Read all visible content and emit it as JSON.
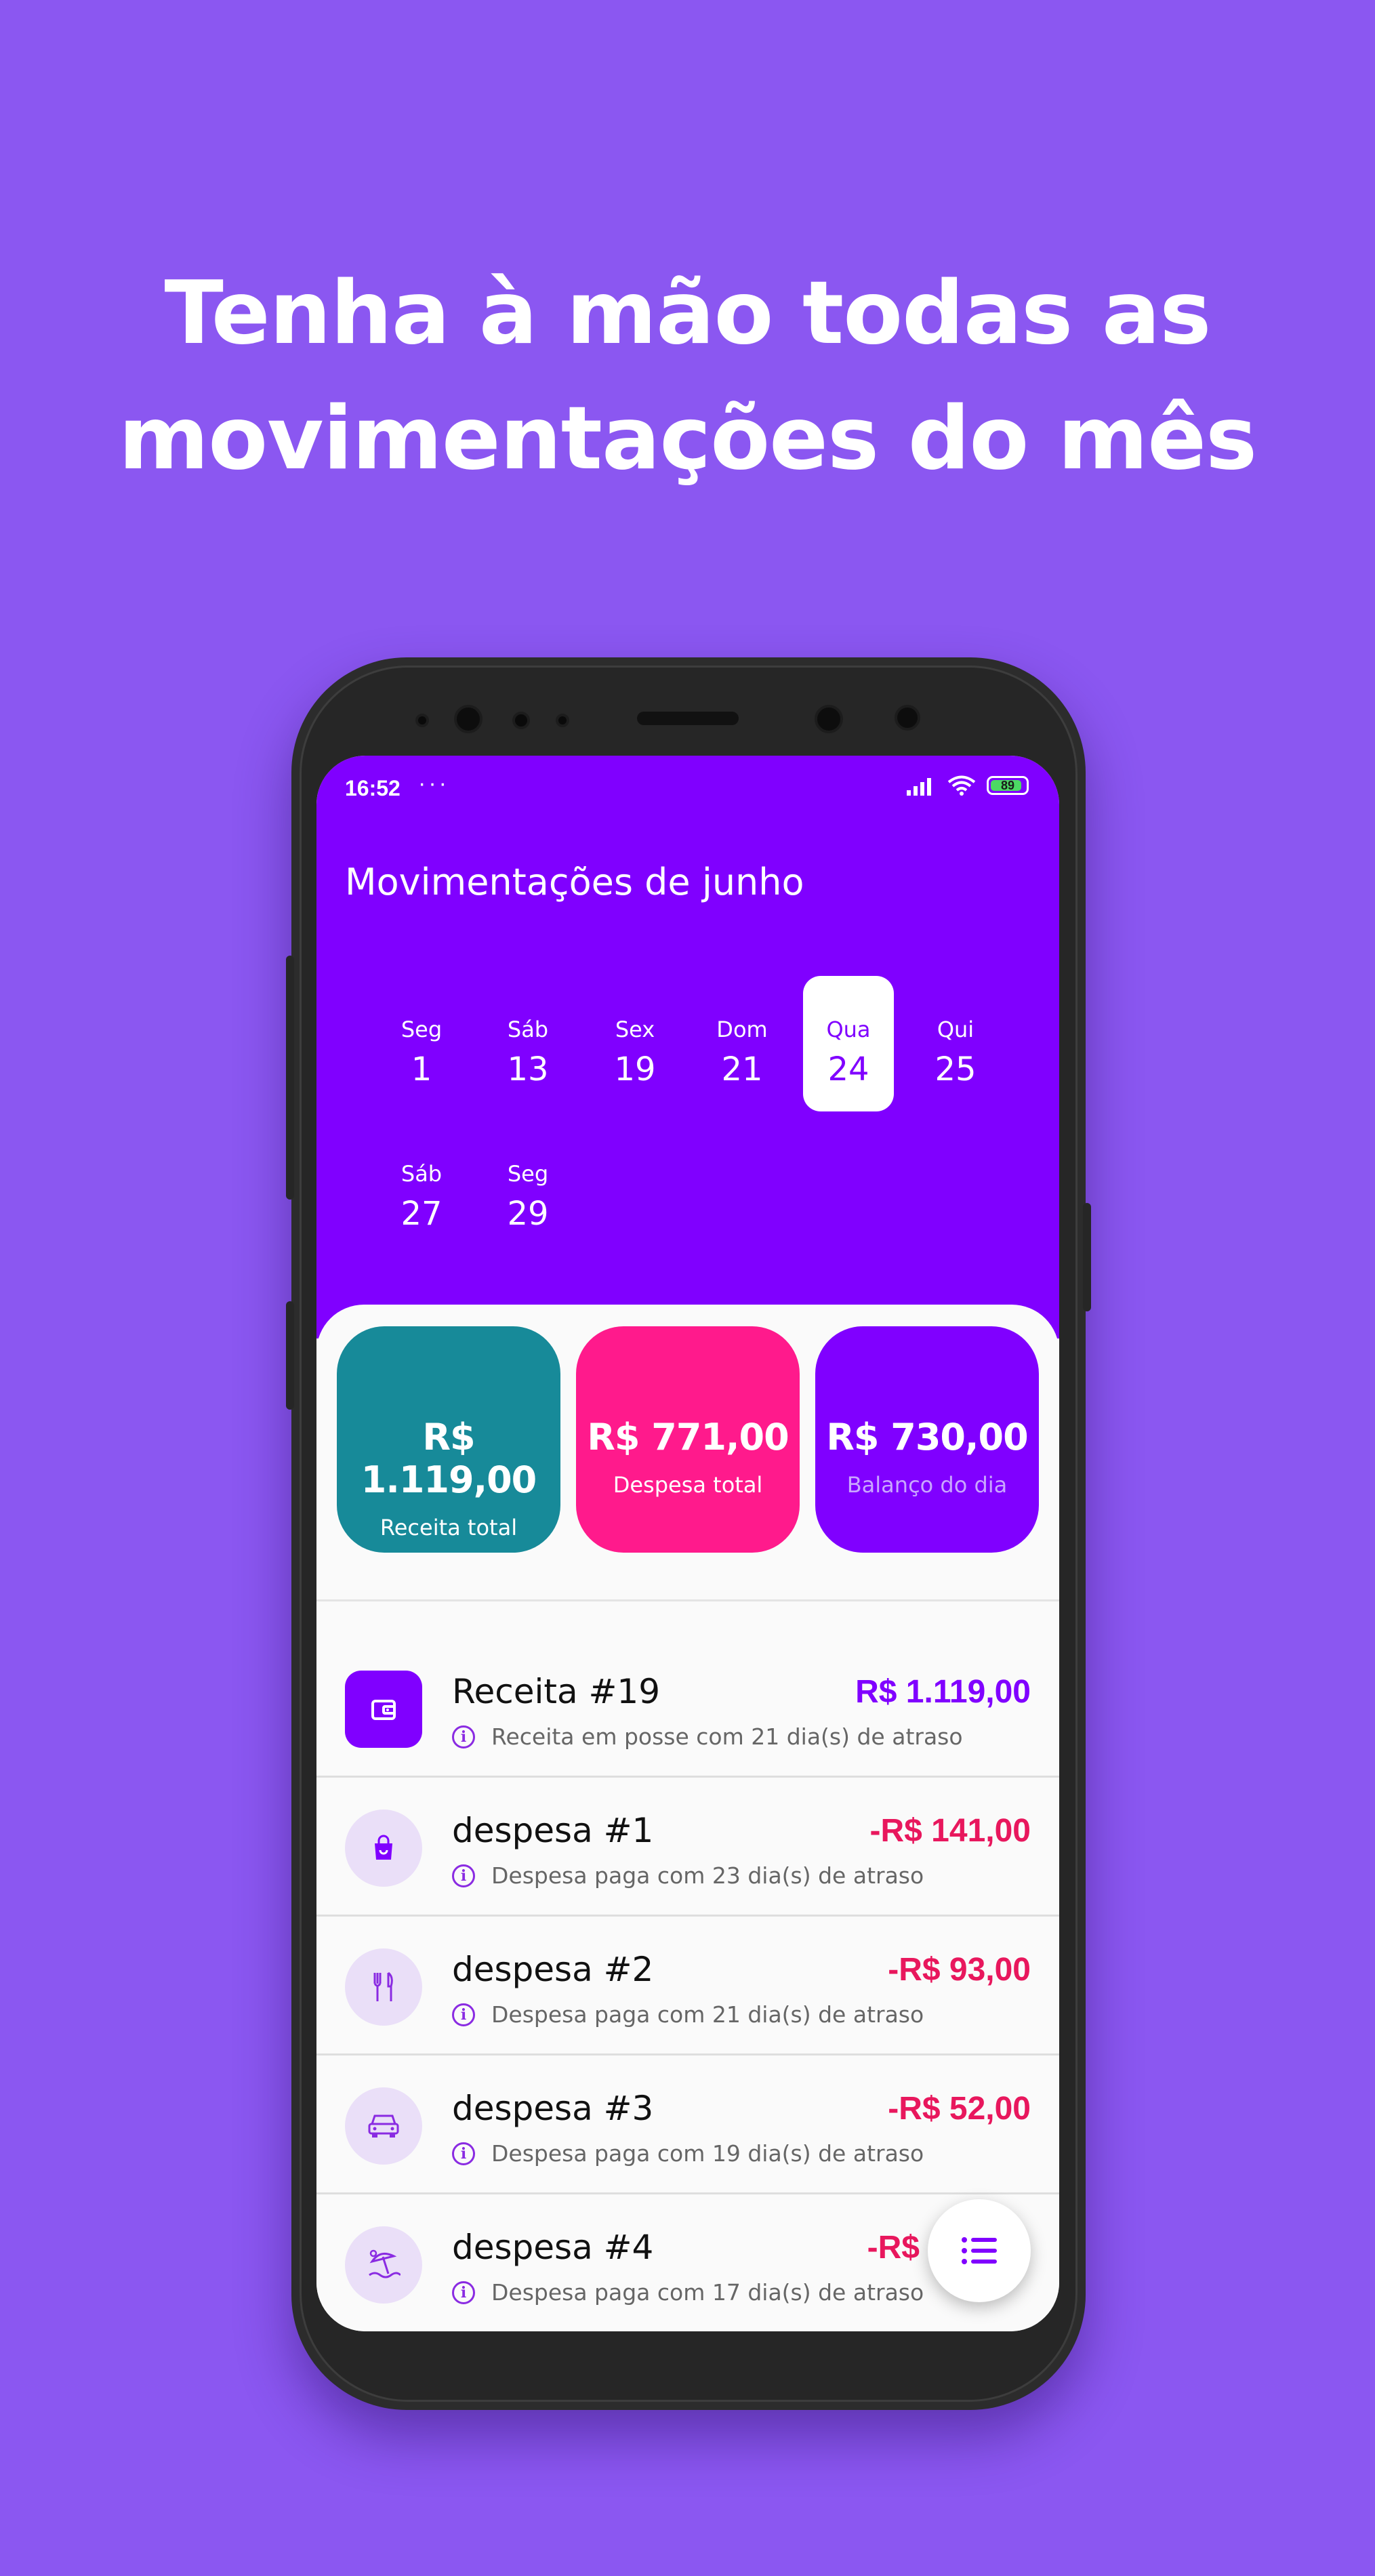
{
  "headline": {
    "line1": "Tenha à mão todas as",
    "line2": "movimentações do mês"
  },
  "status_bar": {
    "time": "16:52",
    "dots": "···",
    "battery": "89"
  },
  "screen_title": "Movimentações de junho",
  "days": [
    {
      "name": "Seg",
      "num": "1"
    },
    {
      "name": "Sáb",
      "num": "13"
    },
    {
      "name": "Sex",
      "num": "19"
    },
    {
      "name": "Dom",
      "num": "21"
    },
    {
      "name": "Qua",
      "num": "24",
      "selected": true
    },
    {
      "name": "Qui",
      "num": "25"
    },
    {
      "name": "Sáb",
      "num": "27"
    },
    {
      "name": "Seg",
      "num": "29"
    }
  ],
  "summary": {
    "income": {
      "amount": "R$ 1.119,00",
      "label": "Receita total",
      "color": "#178a99"
    },
    "expense": {
      "amount": "R$ 771,00",
      "label": "Despesa total",
      "color": "#ff1a8c"
    },
    "balance": {
      "amount": "R$ 730,00",
      "label": "Balanço do dia",
      "color": "#8000ff"
    }
  },
  "transactions": [
    {
      "title": "Receita #19",
      "amount": "R$ 1.119,00",
      "sub": "Receita em posse com 21 dia(s) de atraso",
      "icon": "wallet-icon",
      "type": "income"
    },
    {
      "title": "despesa #1",
      "amount": "-R$ 141,00",
      "sub": "Despesa paga com 23 dia(s) de atraso",
      "icon": "shopping-bag-icon",
      "type": "expense"
    },
    {
      "title": "despesa #2",
      "amount": "-R$ 93,00",
      "sub": "Despesa paga com 21 dia(s) de atraso",
      "icon": "restaurant-icon",
      "type": "expense"
    },
    {
      "title": "despesa #3",
      "amount": "-R$ 52,00",
      "sub": "Despesa paga com 19 dia(s) de atraso",
      "icon": "car-icon",
      "type": "expense"
    },
    {
      "title": "despesa #4",
      "amount": "-R$",
      "sub": "Despesa paga com 17 dia(s) de atraso",
      "icon": "beach-icon",
      "type": "expense"
    }
  ],
  "colors": {
    "income_amount": "#8000ff",
    "expense_amount": "#e8175d",
    "accent": "#8000ff",
    "background": "#8b57f1"
  },
  "fab_icon": "list-icon"
}
